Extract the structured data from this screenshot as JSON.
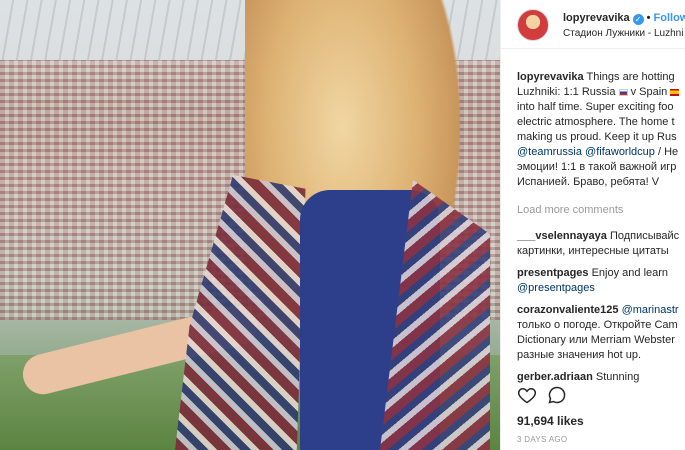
{
  "post": {
    "username": "lopyrevavika",
    "follow_label": "Follow",
    "location": "Стадион Лужники - Luzhni",
    "verified": true
  },
  "caption": {
    "username": "lopyrevavika",
    "line1": "Things are hotting",
    "line2a": "Luzhniki: 1:1 Russia",
    "line2b": "v Spain",
    "line3": "into half time. Super exciting foo",
    "line4": "electric atmosphere. The home t",
    "line5": "making us proud. Keep it up Rus",
    "line6_tag1": "@teamrussia",
    "line6_tag2": "@fifaworldcup",
    "line6_rest": "/ He",
    "line7": "эмоции! 1:1 в такой важной игр",
    "line8": "Испанией. Браво, ребята! V"
  },
  "load_more": "Load more comments",
  "comments": [
    {
      "user": "___vselennayaya",
      "text1": "Подписывайс",
      "text2": "картинки, интересные цитаты"
    },
    {
      "user": "presentpages",
      "text1": "Enjoy and learn",
      "text2": "@presentpages"
    },
    {
      "user": "corazonvaliente125",
      "text1": "@marinastr",
      "text2": "только о погоде. Откройте Cam",
      "text3": "Dictionary или Merriam Webster",
      "text4": "разные значения hot up."
    },
    {
      "user": "gerber.adriaan",
      "text1": "Stunning"
    }
  ],
  "likes": "91,694 likes",
  "timestamp": "3 DAYS AGO",
  "colors": {
    "link": "#3897f0",
    "tag": "#003569",
    "muted": "#999999"
  },
  "icons": {
    "like": "heart-icon",
    "comment": "comment-bubble-icon",
    "verified": "verified-badge-icon"
  }
}
